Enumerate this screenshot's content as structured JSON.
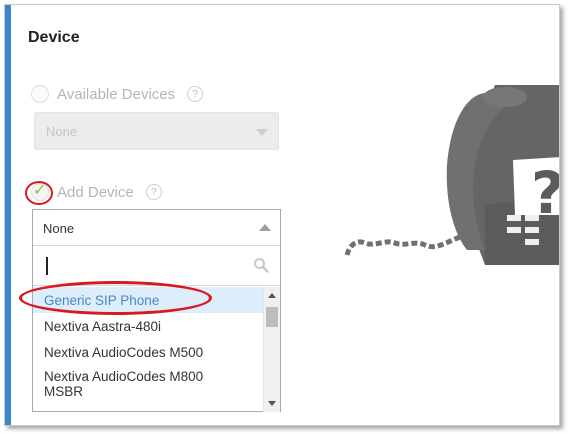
{
  "section": {
    "title": "Device"
  },
  "available_devices": {
    "label": "Available Devices",
    "help": "?",
    "selected": "None"
  },
  "add_device": {
    "label": "Add Device",
    "help": "?",
    "checked": true
  },
  "dropdown": {
    "selected": "None",
    "search_value": "",
    "options": [
      {
        "label": "Generic SIP Phone",
        "highlighted": true
      },
      {
        "label": "Nextiva Aastra-480i"
      },
      {
        "label": "Nextiva AudioCodes M500"
      },
      {
        "label": "Nextiva AudioCodes M800 MSBR"
      }
    ]
  },
  "colors": {
    "accent": "#3d84cf",
    "highlight_annotation": "#d71920",
    "checkmark": "#8bc34a",
    "selected_option_text": "#4b87c5"
  }
}
